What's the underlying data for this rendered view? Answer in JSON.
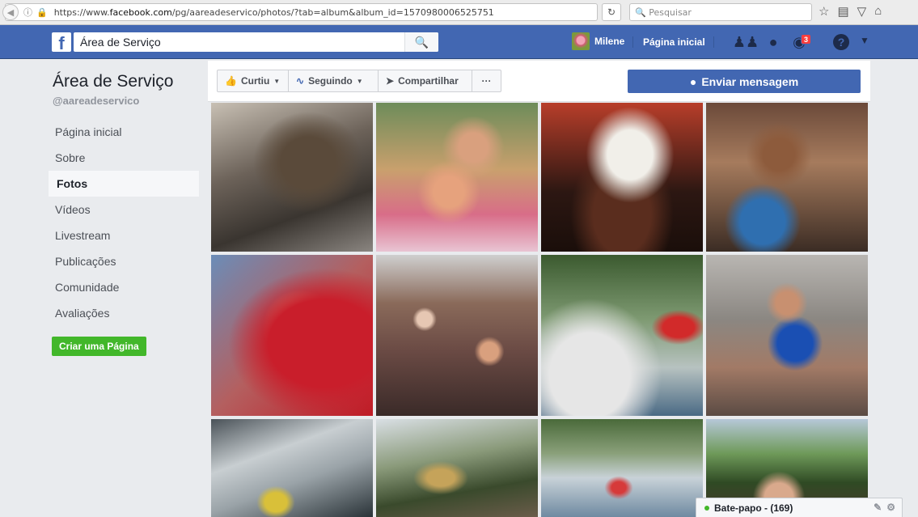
{
  "browser": {
    "url_prefix": "https://www.",
    "url_host": "facebook.com",
    "url_path": "/pg/aareadeservico/photos/?tab=album&album_id=1570980006525751",
    "search_placeholder": "Pesquisar"
  },
  "header": {
    "search_value": "Área de Serviço",
    "user_name": "Milene",
    "home_label": "Página inicial",
    "notifications_count": "3"
  },
  "page": {
    "title": "Área de Serviço",
    "handle": "@aareadeservico"
  },
  "nav": {
    "items": [
      {
        "label": "Página inicial"
      },
      {
        "label": "Sobre"
      },
      {
        "label": "Fotos"
      },
      {
        "label": "Vídeos"
      },
      {
        "label": "Livestream"
      },
      {
        "label": "Publicações"
      },
      {
        "label": "Comunidade"
      },
      {
        "label": "Avaliações"
      }
    ],
    "active_index": 2,
    "create_page_label": "Criar uma Página"
  },
  "actions": {
    "liked_label": "Curtiu",
    "following_label": "Seguindo",
    "share_label": "Compartilhar",
    "more_label": "···",
    "message_label": "Enviar mensagem"
  },
  "chat": {
    "label": "Bate-papo - (169)"
  },
  "colors": {
    "brand": "#4267b2",
    "green": "#42b72a",
    "badge": "#fa3e3e"
  },
  "icons": [
    "info-icon",
    "lock-icon",
    "reload-icon",
    "search-icon",
    "star-icon",
    "bookmarks-icon",
    "pocket-icon",
    "home-icon",
    "facebook-logo",
    "friends-icon",
    "messenger-icon",
    "globe-icon",
    "help-icon",
    "caret-down-icon",
    "thumbs-up-icon",
    "rss-icon",
    "share-arrow-icon",
    "messenger-bubble-icon",
    "compose-icon",
    "gear-icon"
  ]
}
